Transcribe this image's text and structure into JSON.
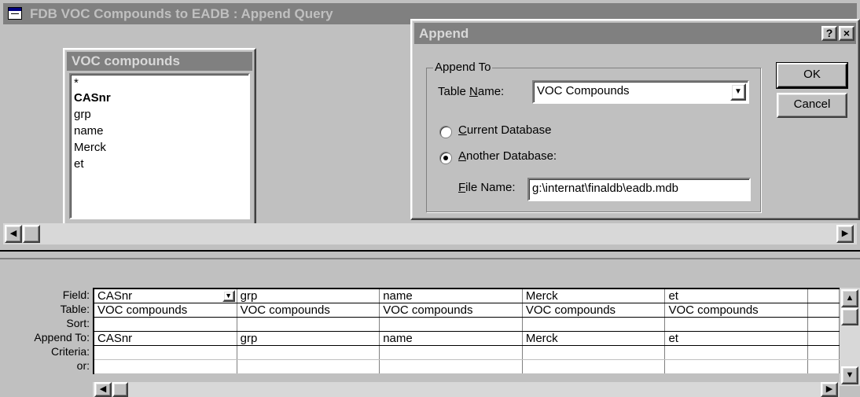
{
  "query_window": {
    "title": "FDB VOC Compounds to EADB : Append Query"
  },
  "field_list": {
    "title": "VOC compounds",
    "items": [
      "*",
      "CASnr",
      "grp",
      "name",
      "Merck",
      "et"
    ]
  },
  "design_grid": {
    "row_labels": [
      "Field:",
      "Table:",
      "Sort:",
      "Append To:",
      "Criteria:",
      "or:"
    ],
    "columns": [
      {
        "field": "CASnr",
        "table": "VOC compounds",
        "sort": "",
        "append_to": "CASnr"
      },
      {
        "field": "grp",
        "table": "VOC compounds",
        "sort": "",
        "append_to": "grp"
      },
      {
        "field": "name",
        "table": "VOC compounds",
        "sort": "",
        "append_to": "name"
      },
      {
        "field": "Merck",
        "table": "VOC compounds",
        "sort": "",
        "append_to": "Merck"
      },
      {
        "field": "et",
        "table": "VOC compounds",
        "sort": "",
        "append_to": "et"
      }
    ]
  },
  "append_dialog": {
    "title": "Append",
    "help_label": "?",
    "close_label": "×",
    "group_label": "Append To",
    "table_name_prefix": "Table ",
    "table_name_u": "N",
    "table_name_suffix": "ame:",
    "table_name_value": "VOC Compounds",
    "current_db_u": "C",
    "current_db_rest": "urrent Database",
    "another_db_u": "A",
    "another_db_rest": "nother Database:",
    "selected_option": "another",
    "file_name_u": "F",
    "file_name_rest": "ile Name:",
    "file_name_value": "g:\\internat\\finaldb\\eadb.mdb",
    "ok_label": "OK",
    "cancel_label": "Cancel"
  },
  "icons": {
    "dropdown": "▼",
    "left_arrow": "◀",
    "right_arrow": "▶",
    "up_arrow": "▲",
    "down_arrow": "▼"
  }
}
